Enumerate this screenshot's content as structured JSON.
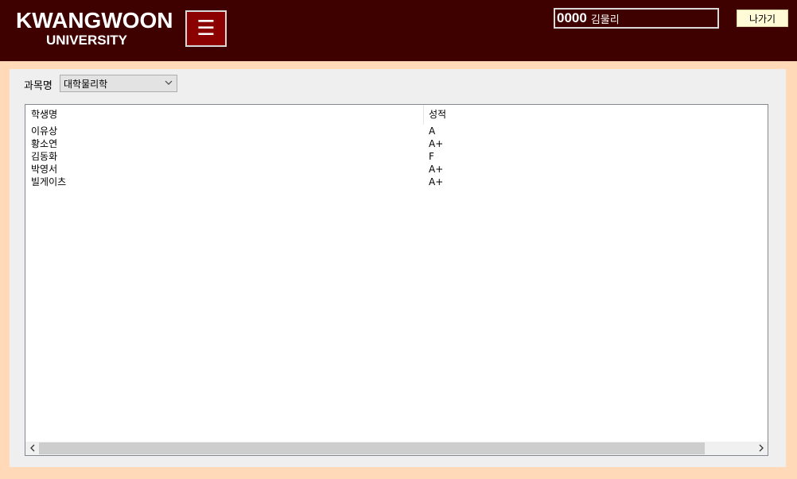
{
  "header": {
    "logo_title": "KWANGWOON",
    "logo_subtitle": "UNIVERSITY",
    "menu_icon": "☰",
    "user_id": "0000",
    "user_name": "김물리",
    "exit_label": "나가기"
  },
  "filter": {
    "subject_label": "과목명",
    "subject_selected": "대학물리학"
  },
  "table": {
    "columns": [
      "학생명",
      "성적"
    ],
    "rows": [
      {
        "name": "이유상",
        "grade": "A"
      },
      {
        "name": "황소연",
        "grade": "A+"
      },
      {
        "name": "김동화",
        "grade": "F"
      },
      {
        "name": "박영서",
        "grade": "A+"
      },
      {
        "name": "빌게이츠",
        "grade": "A+"
      }
    ]
  },
  "colors": {
    "header_bg": "#3f0000",
    "menu_btn_bg": "#8b0000",
    "page_bg": "#ffd9b8",
    "panel_bg": "#efefef",
    "exit_btn_bg": "#fffbd6"
  }
}
